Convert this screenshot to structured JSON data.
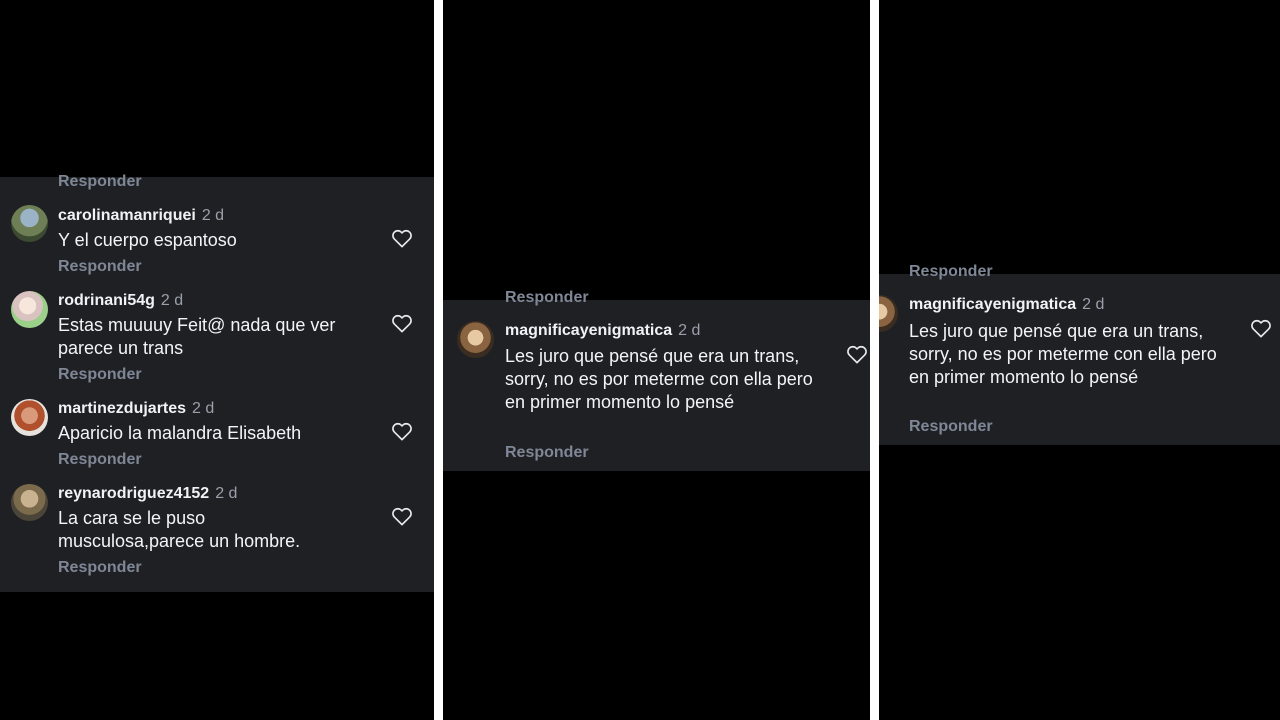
{
  "panels": [
    {
      "cut_reply_label": "Responder",
      "comments": [
        {
          "username": "carolinamanriquei",
          "time": "2 d",
          "text": "Y el cuerpo espantoso",
          "reply": "Responder"
        },
        {
          "username": "rodrinani54g",
          "time": "2 d",
          "text": "Estas muuuuy Feit@ nada que ver parece un trans",
          "reply": "Responder"
        },
        {
          "username": "martinezdujartes",
          "time": "2 d",
          "text": "Aparicio la malandra Elisabeth",
          "reply": "Responder"
        },
        {
          "username": "reynarodriguez4152",
          "time": "2 d",
          "text": "La cara se le puso musculosa,parece un hombre.",
          "reply": "Responder"
        }
      ]
    },
    {
      "cut_reply_label": "Responder",
      "comments": [
        {
          "username": "magnificayenigmatica",
          "time": "2 d",
          "text": "Les juro que pensé que era un trans, sorry, no es por meterme con ella pero en primer momento lo pensé",
          "reply": "Responder"
        }
      ]
    },
    {
      "cut_reply_label": "Responder",
      "comments": [
        {
          "username": "magnificayenigmatica",
          "time": "2 d",
          "text": "Les juro que pensé que era un trans, sorry, no es por meterme con ella pero en primer momento lo pensé",
          "reply": "Responder"
        }
      ]
    }
  ],
  "icons": {
    "like": "heart-outline-icon"
  },
  "colors": {
    "background": "#000000",
    "card": "#1f2024",
    "text": "#f3f4f6",
    "muted": "#7f8796",
    "separator": "#ffffff"
  }
}
